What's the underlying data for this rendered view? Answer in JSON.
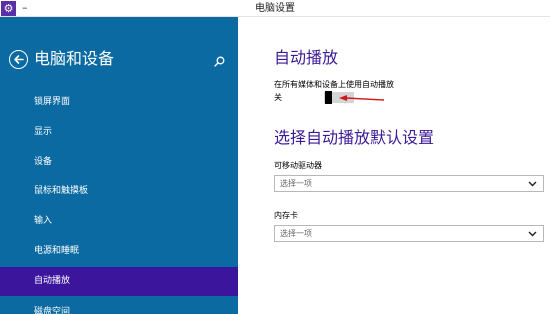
{
  "window": {
    "title": "电脑设置",
    "menu_glyph": "–",
    "app_icon": "gear-icon",
    "accent": "#3b169c",
    "sidebar_bg": "#0a6aa1"
  },
  "sidebar": {
    "title": "电脑和设备",
    "back_icon": "back-arrow-icon",
    "search_icon": "search-icon",
    "items": [
      {
        "label": "锁屏界面",
        "active": false
      },
      {
        "label": "显示",
        "active": false
      },
      {
        "label": "设备",
        "active": false
      },
      {
        "label": "鼠标和触摸板",
        "active": false
      },
      {
        "label": "输入",
        "active": false
      },
      {
        "label": "电源和睡眠",
        "active": false
      },
      {
        "label": "自动播放",
        "active": true
      },
      {
        "label": "磁盘空间",
        "active": false
      }
    ]
  },
  "main": {
    "autoplay_heading": "自动播放",
    "toggle_label": "在所有媒体和设备上使用自动播放",
    "toggle_state": "关",
    "defaults_heading": "选择自动播放默认设置",
    "removable_drive": {
      "label": "可移动驱动器",
      "value": "选择一项"
    },
    "memory_card": {
      "label": "内存卡",
      "value": "选择一项"
    }
  }
}
